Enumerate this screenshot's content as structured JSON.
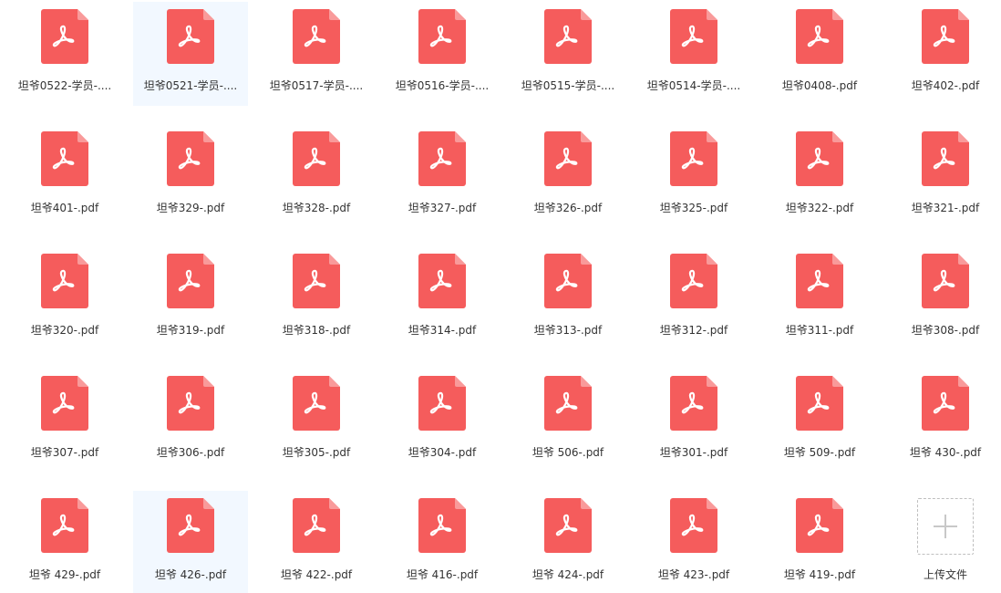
{
  "colors": {
    "pdf_red": "#f55c5c",
    "pdf_fold": "#f99a9a",
    "selected_bg": "#f2f8ff",
    "upload_border": "#bfbfbf",
    "upload_plus": "#c8c8c8"
  },
  "icons": {
    "file": "pdf-file-icon",
    "upload": "plus-icon"
  },
  "files": [
    {
      "name": "坦爷0522-学员-....",
      "selected": false
    },
    {
      "name": "坦爷0521-学员-....",
      "selected": true
    },
    {
      "name": "坦爷0517-学员-....",
      "selected": false
    },
    {
      "name": "坦爷0516-学员-....",
      "selected": false
    },
    {
      "name": "坦爷0515-学员-....",
      "selected": false
    },
    {
      "name": "坦爷0514-学员-....",
      "selected": false
    },
    {
      "name": "坦爷0408-.pdf",
      "selected": false
    },
    {
      "name": "坦爷402-.pdf",
      "selected": false
    },
    {
      "name": "坦爷401-.pdf",
      "selected": false
    },
    {
      "name": "坦爷329-.pdf",
      "selected": false
    },
    {
      "name": "坦爷328-.pdf",
      "selected": false
    },
    {
      "name": "坦爷327-.pdf",
      "selected": false
    },
    {
      "name": "坦爷326-.pdf",
      "selected": false
    },
    {
      "name": "坦爷325-.pdf",
      "selected": false
    },
    {
      "name": "坦爷322-.pdf",
      "selected": false
    },
    {
      "name": "坦爷321-.pdf",
      "selected": false
    },
    {
      "name": "坦爷320-.pdf",
      "selected": false
    },
    {
      "name": "坦爷319-.pdf",
      "selected": false
    },
    {
      "name": "坦爷318-.pdf",
      "selected": false
    },
    {
      "name": "坦爷314-.pdf",
      "selected": false
    },
    {
      "name": "坦爷313-.pdf",
      "selected": false
    },
    {
      "name": "坦爷312-.pdf",
      "selected": false
    },
    {
      "name": "坦爷311-.pdf",
      "selected": false
    },
    {
      "name": "坦爷308-.pdf",
      "selected": false
    },
    {
      "name": "坦爷307-.pdf",
      "selected": false
    },
    {
      "name": "坦爷306-.pdf",
      "selected": false
    },
    {
      "name": "坦爷305-.pdf",
      "selected": false
    },
    {
      "name": "坦爷304-.pdf",
      "selected": false
    },
    {
      "name": "坦爷 506-.pdf",
      "selected": false
    },
    {
      "name": "坦爷301-.pdf",
      "selected": false
    },
    {
      "name": "坦爷 509-.pdf",
      "selected": false
    },
    {
      "name": "坦爷 430-.pdf",
      "selected": false
    },
    {
      "name": "坦爷 429-.pdf",
      "selected": false
    },
    {
      "name": "坦爷 426-.pdf",
      "selected": true
    },
    {
      "name": "坦爷 422-.pdf",
      "selected": false
    },
    {
      "name": "坦爷 416-.pdf",
      "selected": false
    },
    {
      "name": "坦爷 424-.pdf",
      "selected": false
    },
    {
      "name": "坦爷 423-.pdf",
      "selected": false
    },
    {
      "name": "坦爷 419-.pdf",
      "selected": false
    }
  ],
  "upload": {
    "label": "上传文件"
  }
}
